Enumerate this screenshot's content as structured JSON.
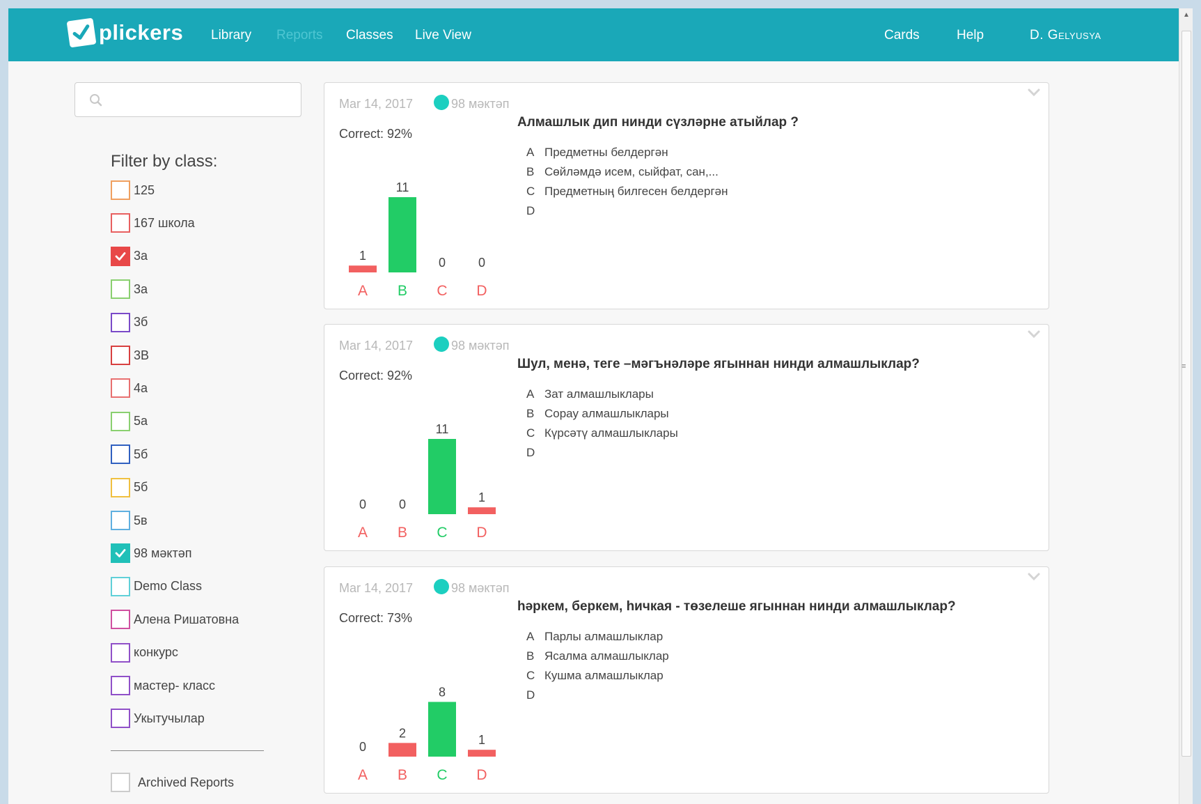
{
  "nav": {
    "brand": "plickers",
    "links": [
      "Library",
      "Reports",
      "Classes",
      "Live View"
    ],
    "right_links": [
      "Cards",
      "Help"
    ],
    "user": "D. Gelyusya",
    "colors": {
      "bar": "#1aa8b8",
      "active_dim": "#4fc6d2"
    }
  },
  "search": {
    "placeholder": "",
    "value": ""
  },
  "filter": {
    "title": "Filter by class:",
    "classes": [
      {
        "label": "125",
        "color": "#f0a060",
        "checked": false
      },
      {
        "label": "167 школа",
        "color": "#e86060",
        "checked": false
      },
      {
        "label": "3а",
        "color": "#e84848",
        "checked": true
      },
      {
        "label": "3а",
        "color": "#8ad070",
        "checked": false
      },
      {
        "label": "3б",
        "color": "#7a4ac8",
        "checked": false
      },
      {
        "label": "3В",
        "color": "#d84040",
        "checked": false
      },
      {
        "label": "4а",
        "color": "#e87070",
        "checked": false
      },
      {
        "label": "5а",
        "color": "#8ad070",
        "checked": false
      },
      {
        "label": "5б",
        "color": "#3060c0",
        "checked": false
      },
      {
        "label": "5б",
        "color": "#f0c040",
        "checked": false
      },
      {
        "label": "5в",
        "color": "#60b0e0",
        "checked": false
      },
      {
        "label": "98 мәктәп",
        "color": "#20c0b8",
        "checked": true
      },
      {
        "label": "Demo Class",
        "color": "#60d0d8",
        "checked": false
      },
      {
        "label": "Алена Ришатовна",
        "color": "#d050a0",
        "checked": false
      },
      {
        "label": "конкурс",
        "color": "#9050c8",
        "checked": false
      },
      {
        "label": "мастер- класс",
        "color": "#9050c8",
        "checked": false
      },
      {
        "label": "Укытучылар",
        "color": "#9050c8",
        "checked": false
      }
    ],
    "archived_label": "Archived Reports"
  },
  "reports": [
    {
      "date": "Mar 14, 2017",
      "class_name": "98 мәктәп",
      "correct": "Correct: 92%",
      "question": "Алмашлык дип нинди сүзләрне атыйлар ?",
      "answers": [
        {
          "letter": "A",
          "text": "Предметны белдергән"
        },
        {
          "letter": "B",
          "text": "Сөйләмдә исем, сыйфат, сан,..."
        },
        {
          "letter": "C",
          "text": "Предметның билгесен белдергән"
        },
        {
          "letter": "D",
          "text": ""
        }
      ],
      "chart_data": {
        "type": "bar",
        "categories": [
          "A",
          "B",
          "C",
          "D"
        ],
        "values": [
          1,
          11,
          0,
          0
        ],
        "correct": "B",
        "colors": {
          "correct": "#22cc66",
          "incorrect": "#f26060"
        }
      }
    },
    {
      "date": "Mar 14, 2017",
      "class_name": "98 мәктәп",
      "correct": "Correct: 92%",
      "question": "Шул, менә, теге –мәгънәләре ягыннан нинди алмашлыклар?",
      "answers": [
        {
          "letter": "A",
          "text": "Зат алмашлыклары"
        },
        {
          "letter": "B",
          "text": "Сорау алмашлыклары"
        },
        {
          "letter": "C",
          "text": "Күрсәтү алмашлыклары"
        },
        {
          "letter": "D",
          "text": ""
        }
      ],
      "chart_data": {
        "type": "bar",
        "categories": [
          "A",
          "B",
          "C",
          "D"
        ],
        "values": [
          0,
          0,
          11,
          1
        ],
        "correct": "C",
        "colors": {
          "correct": "#22cc66",
          "incorrect": "#f26060"
        }
      }
    },
    {
      "date": "Mar 14, 2017",
      "class_name": "98 мәктәп",
      "correct": "Correct: 73%",
      "question": "һәркем, беркем, һичкая - төзелеше ягыннан нинди алмашлыклар?",
      "answers": [
        {
          "letter": "A",
          "text": "Парлы алмашлыклар"
        },
        {
          "letter": "B",
          "text": "Ясалма алмашлыклар"
        },
        {
          "letter": "C",
          "text": "Кушма алмашлыклар"
        },
        {
          "letter": "D",
          "text": ""
        }
      ],
      "chart_data": {
        "type": "bar",
        "categories": [
          "A",
          "B",
          "C",
          "D"
        ],
        "values": [
          0,
          2,
          8,
          1
        ],
        "correct": "C",
        "colors": {
          "correct": "#22cc66",
          "incorrect": "#f26060"
        }
      }
    }
  ]
}
